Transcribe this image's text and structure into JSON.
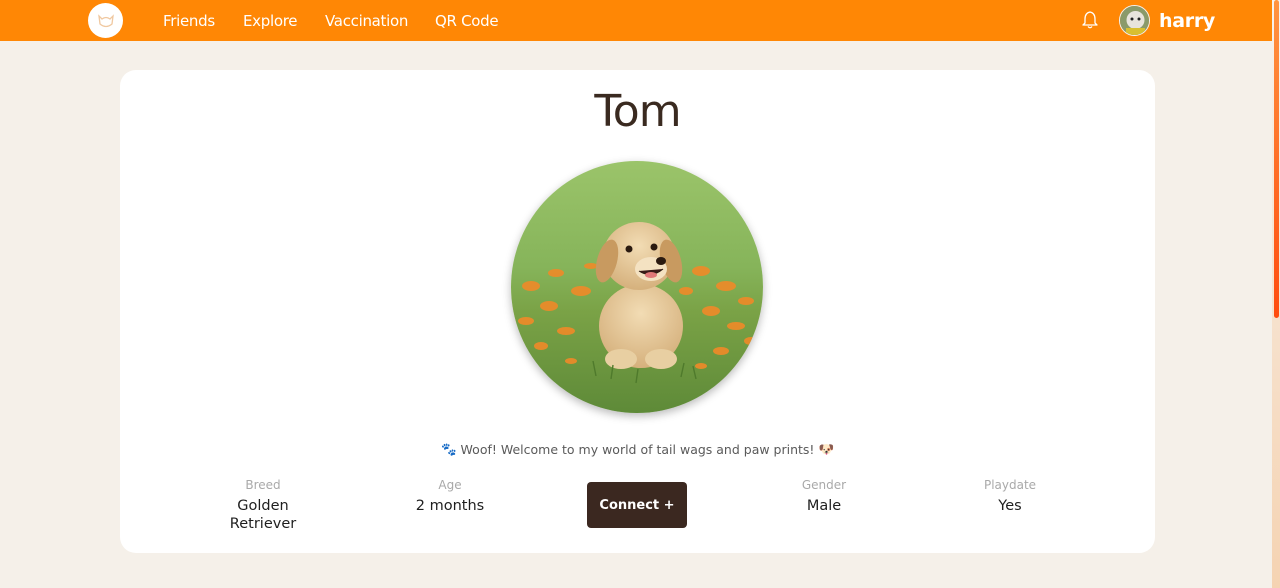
{
  "nav": {
    "links": [
      "Friends",
      "Explore",
      "Vaccination",
      "QR Code"
    ],
    "username": "harry",
    "icons": {
      "logo": "dog-face-icon",
      "bell": "bell-icon",
      "avatar": "user-avatar"
    }
  },
  "profile": {
    "name": "Tom",
    "bio": "Woof! Welcome to my world of tail wags and paw prints!",
    "bio_prefix_emoji": "🐾",
    "bio_suffix_emoji": "🐶",
    "stats": [
      {
        "label": "Breed",
        "value": "Golden Retriever"
      },
      {
        "label": "Age",
        "value": "2 months"
      },
      {
        "label": "Gender",
        "value": "Male"
      },
      {
        "label": "Playdate",
        "value": "Yes"
      }
    ],
    "connect_label": "Connect +"
  },
  "colors": {
    "navbar": "#ff8705",
    "background": "#f5f0e9",
    "button": "#3b2820"
  }
}
